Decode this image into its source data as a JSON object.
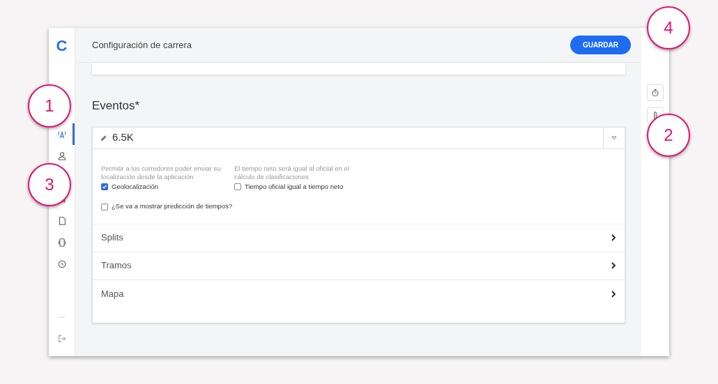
{
  "header": {
    "title": "Configuración de carrera",
    "save_button": "GUARDAR"
  },
  "logo": "C",
  "sidebar": {
    "items": [
      {
        "kind": "antenna",
        "selected": true
      },
      {
        "kind": "person",
        "selected": false
      },
      {
        "kind": "bars",
        "selected": false
      },
      {
        "kind": "document",
        "selected": false
      },
      {
        "kind": "phone",
        "selected": false
      },
      {
        "kind": "clock",
        "selected": false
      }
    ],
    "bottom": [
      {
        "kind": "more"
      },
      {
        "kind": "logout"
      }
    ]
  },
  "section_title": "Eventos*",
  "event": {
    "name": "6.5K",
    "options": [
      {
        "hint": "Permitir a los corredores poder enviar su localización desde la aplicación",
        "label": "Geolocalización",
        "checked": true
      },
      {
        "hint": "El tiempo neto será igual al oficial en el cálculo de clasificaciones",
        "label": "Tiempo oficial igual a tiempo neto",
        "checked": false
      }
    ],
    "prediction": {
      "label": "¿Se va a mostrar predicción de tiempos?",
      "checked": false
    },
    "sections": [
      "Splits",
      "Tramos",
      "Mapa"
    ]
  },
  "right_rail": [
    {
      "kind": "stopwatch"
    },
    {
      "kind": "thermometer"
    }
  ],
  "callouts": [
    "1",
    "2",
    "3",
    "4"
  ]
}
